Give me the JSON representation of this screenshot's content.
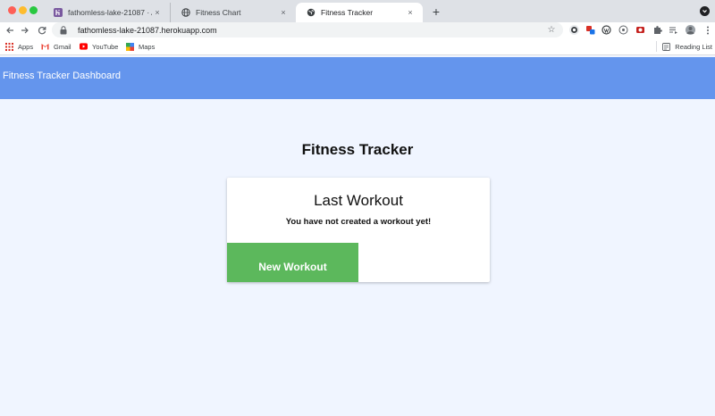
{
  "browser": {
    "tabs": [
      {
        "title": "fathomless-lake-21087 · Activi",
        "favicon": "heroku-icon"
      },
      {
        "title": "Fitness Chart",
        "favicon": "globe-icon"
      },
      {
        "title": "Fitness Tracker",
        "favicon": "globe-icon",
        "active": true
      }
    ],
    "new_tab": "+",
    "close_glyph": "×",
    "url": "fathomless-lake-21087.herokuapp.com",
    "bookmarks": [
      {
        "label": "Apps",
        "icon": "apps-grid-icon"
      },
      {
        "label": "Gmail",
        "icon": "gmail-icon"
      },
      {
        "label": "YouTube",
        "icon": "youtube-icon"
      },
      {
        "label": "Maps",
        "icon": "maps-icon"
      }
    ],
    "reading_list": "Reading List"
  },
  "navbar": {
    "brand": "Fitness Tracker Dashboard",
    "background": "#6495ed"
  },
  "main": {
    "heading": "Fitness Tracker",
    "card": {
      "title": "Last Workout",
      "subtitle": "You have not created a workout yet!",
      "button_label": "New Workout",
      "button_color": "#5cb85c"
    }
  }
}
